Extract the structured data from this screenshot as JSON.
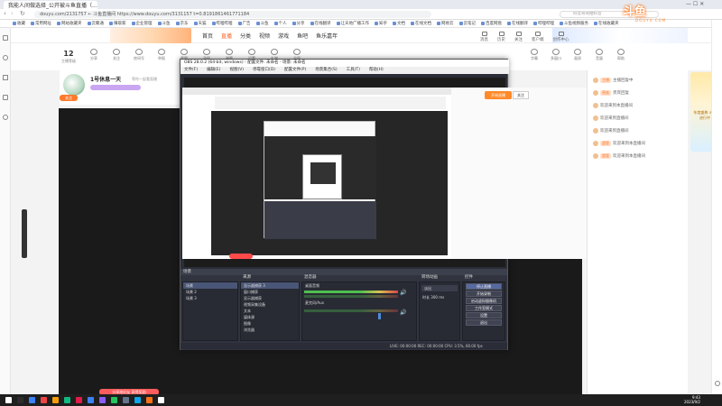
{
  "browser": {
    "tab_title": "我能人间做选择_公开被斗鱼直播（...）",
    "url": "douyu.com/2131757 ← 斗鱼直播间 https://www.douyu.com/3131157 t=0.8191861461771184",
    "search_placeholder": "抖音哥哥拍抖音",
    "bookmarks": [
      "收藏",
      "常用网址",
      "网站收藏夹",
      "云聚通",
      "赚取家",
      "企业管理",
      "斗鱼",
      "京东",
      "天猫",
      "哔哩哔哩",
      "广告",
      "斗鱼",
      "个人",
      "分享",
      "在线翻译",
      "让天地广播工作",
      "知乎",
      "文档",
      "在线文档",
      "网易云",
      "云笔记",
      "百度网盘",
      "在线翻译",
      "哔哩哔哩",
      "斗鱼视频服务",
      "在线收藏夹"
    ]
  },
  "site": {
    "nav": [
      "首页",
      "直播",
      "分类",
      "视频",
      "游戏",
      "鱼吧",
      "鱼乐嘉年"
    ],
    "active_nav_index": 1,
    "header_icons": [
      "消息",
      "历史",
      "关注",
      "客户端",
      "创作中心"
    ],
    "logo_text": "斗鱼",
    "logo_sub": "DOUYU.COM"
  },
  "room": {
    "count": "12",
    "count_label": "主播等级",
    "tools": [
      "分享",
      "关注",
      "房间号",
      "举报",
      "截图",
      "录屏",
      "弹幕",
      "设置",
      "礼物",
      "全屏"
    ],
    "right_tools": [
      "字幕",
      "多窗口",
      "画质",
      "音量",
      "帮助"
    ]
  },
  "streamer": {
    "name": "1号休息一天",
    "sub": "等你一起看直播",
    "follow": "关注"
  },
  "obs": {
    "title": "OBS 28.0.2 (64-bit, windows) - 配置文件: 未命名 - 场景: 未命名",
    "menu": [
      "文件(F)",
      "编辑(E)",
      "视图(V)",
      "停靠窗口(D)",
      "配置文件(P)",
      "场景集合(S)",
      "工具(T)",
      "帮助(H)"
    ],
    "side_button": "开始直播",
    "side_button2": "关注",
    "dock_titles": [
      "场景",
      "来源",
      "混音器",
      "转场动画",
      "控件"
    ],
    "scenes": [
      "场景",
      "场景 2",
      "场景 3"
    ],
    "sources": [
      "显示器捕获 3",
      "窗口捕获",
      "显示器捕获",
      "视频采集设备",
      "文本",
      "媒体源",
      "图像",
      "浏览器"
    ],
    "mixer": [
      "桌面音频",
      "麦克风/Aux"
    ],
    "transition": "淡出",
    "transition_duration_label": "时长",
    "transition_duration": "300 ms",
    "controls": [
      "停止直播",
      "开始录制",
      "启动虚拟摄像机",
      "工作室模式",
      "设置",
      "退出"
    ],
    "status": "LIVE: 00:00:00   REC: 00:00:00   CPU: 3.5%, 60.00 fps"
  },
  "chat": {
    "lines": [
      {
        "badge": "主播",
        "text": "主播回复中"
      },
      {
        "badge": "贵族",
        "text": "贵宾回复"
      },
      {
        "badge": "",
        "text": "欢迎来到本直播间"
      },
      {
        "badge": "",
        "text": "欢迎来到直播间"
      },
      {
        "badge": "",
        "text": "欢迎来到直播间"
      },
      {
        "badge": "超管",
        "text": "欢迎来到本直播间"
      },
      {
        "badge": "超管",
        "text": "欢迎来到本直播间"
      }
    ],
    "ad_text": "年度盛典 火爆进行中"
  },
  "promo": "分享给好友 获得奖励",
  "clock": {
    "time": "9:43",
    "date": "2023/9/2"
  },
  "colors": {
    "accent": "#ff5d23",
    "obs_bg": "#2b2e38",
    "live": "#ff4a4a"
  }
}
